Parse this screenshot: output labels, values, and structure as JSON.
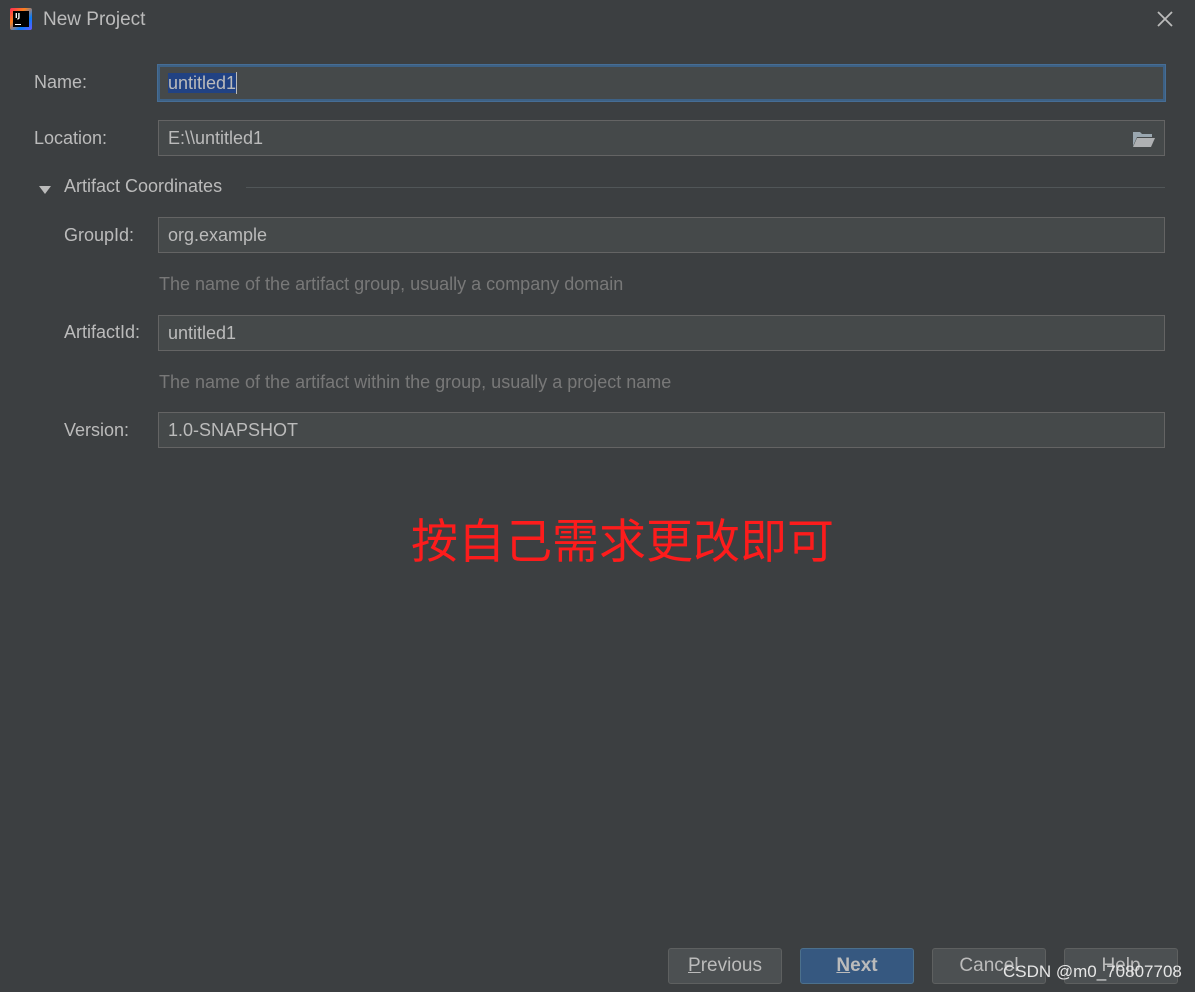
{
  "window": {
    "title": "New Project"
  },
  "form": {
    "name": {
      "label": "Name:",
      "value": "untitled1"
    },
    "location": {
      "label": "Location:",
      "value": "E:\\\\untitled1"
    },
    "section": {
      "title": "Artifact Coordinates",
      "expanded": true
    },
    "group_id": {
      "label": "GroupId:",
      "value": "org.example",
      "hint": "The name of the artifact group, usually a company domain"
    },
    "artifact_id": {
      "label": "ArtifactId:",
      "value": "untitled1",
      "hint": "The name of the artifact within the group, usually a project name"
    },
    "version": {
      "label": "Version:",
      "value": "1.0-SNAPSHOT"
    }
  },
  "annotation": {
    "text": "按自己需求更改即可",
    "color": "#fd1c1c"
  },
  "buttons": {
    "previous": {
      "mnemonic": "P",
      "rest": "revious"
    },
    "next": {
      "mnemonic": "N",
      "rest": "ext"
    },
    "cancel": {
      "label": "Cancel"
    },
    "help": {
      "label": "Help"
    }
  },
  "watermark": "CSDN @m0_70807708",
  "colors": {
    "background": "#3c3f41",
    "field_bg": "#45494a",
    "primary_button": "#365880",
    "selection": "#214283"
  }
}
